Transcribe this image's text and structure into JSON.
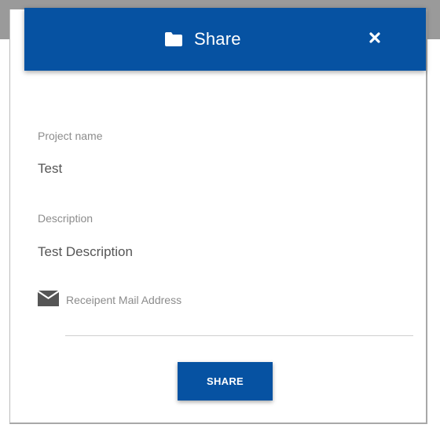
{
  "dialog": {
    "title": "Share",
    "header_icon": "folder-icon",
    "close_icon": "close-icon",
    "accent_color": "#0652a2"
  },
  "fields": {
    "project_name_label": "Project name",
    "project_name_value": "Test",
    "description_label": "Description",
    "description_value": "Test Description"
  },
  "mail": {
    "icon": "envelope-icon",
    "placeholder": "Receipent Mail Address",
    "value": ""
  },
  "actions": {
    "share_label": "SHARE"
  }
}
